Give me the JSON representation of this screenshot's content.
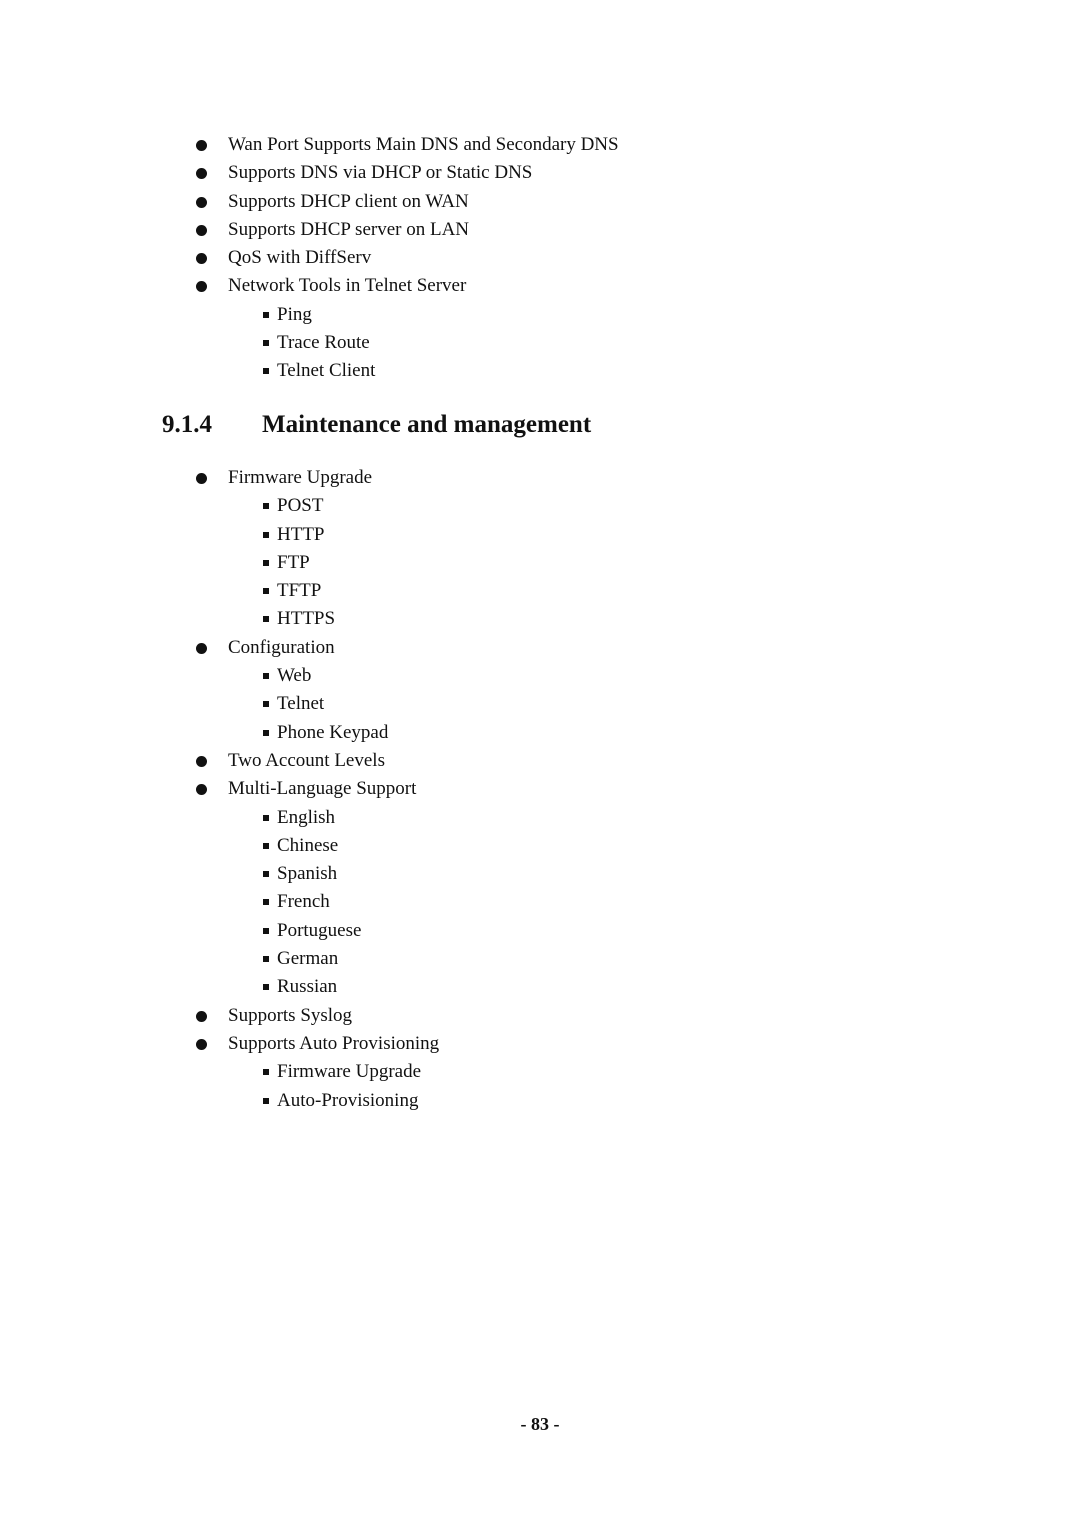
{
  "page": {
    "section_top_items": [
      {
        "level": 1,
        "text": "Wan Port Supports Main DNS and Secondary DNS"
      },
      {
        "level": 1,
        "text": "Supports DNS via DHCP or Static DNS"
      },
      {
        "level": 1,
        "text": "Supports DHCP client on WAN"
      },
      {
        "level": 1,
        "text": "Supports DHCP server on LAN"
      },
      {
        "level": 1,
        "text": "QoS with DiffServ"
      },
      {
        "level": 1,
        "text": "Network Tools in Telnet Server"
      },
      {
        "level": 2,
        "text": "Ping"
      },
      {
        "level": 2,
        "text": "Trace Route"
      },
      {
        "level": 2,
        "text": "Telnet Client"
      }
    ],
    "heading": {
      "number": "9.1.4",
      "title": "Maintenance and management"
    },
    "section_bottom_items": [
      {
        "level": 1,
        "text": "Firmware Upgrade"
      },
      {
        "level": 2,
        "text": "POST"
      },
      {
        "level": 2,
        "text": "HTTP"
      },
      {
        "level": 2,
        "text": "FTP"
      },
      {
        "level": 2,
        "text": "TFTP"
      },
      {
        "level": 2,
        "text": "HTTPS"
      },
      {
        "level": 1,
        "text": "Configuration"
      },
      {
        "level": 2,
        "text": "Web"
      },
      {
        "level": 2,
        "text": "Telnet"
      },
      {
        "level": 2,
        "text": "Phone Keypad"
      },
      {
        "level": 1,
        "text": "Two Account Levels"
      },
      {
        "level": 1,
        "text": "Multi-Language Support"
      },
      {
        "level": 2,
        "text": "English"
      },
      {
        "level": 2,
        "text": "Chinese"
      },
      {
        "level": 2,
        "text": "Spanish"
      },
      {
        "level": 2,
        "text": "French"
      },
      {
        "level": 2,
        "text": "Portuguese"
      },
      {
        "level": 2,
        "text": "German"
      },
      {
        "level": 2,
        "text": "Russian"
      },
      {
        "level": 1,
        "text": "Supports Syslog"
      },
      {
        "level": 1,
        "text": "Supports Auto Provisioning"
      },
      {
        "level": 2,
        "text": "Firmware Upgrade"
      },
      {
        "level": 2,
        "text": "Auto-Provisioning"
      }
    ],
    "footer": {
      "page_number": "- 83 -"
    }
  }
}
